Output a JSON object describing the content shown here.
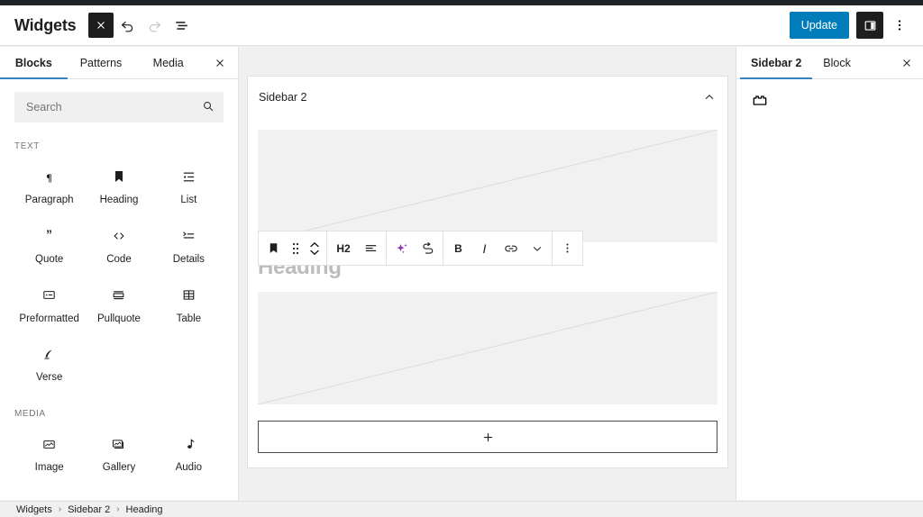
{
  "header": {
    "title": "Widgets",
    "close_label": "Close",
    "undo_label": "Undo",
    "redo_label": "Redo",
    "list_view_label": "List View",
    "update_label": "Update",
    "sidebar_toggle_label": "Settings",
    "options_label": "Options"
  },
  "inserter": {
    "tabs": [
      {
        "label": "Blocks",
        "active": true
      },
      {
        "label": "Patterns",
        "active": false
      },
      {
        "label": "Media",
        "active": false
      }
    ],
    "close_label": "Close block inserter",
    "search": {
      "placeholder": "Search",
      "value": "",
      "icon": "search-icon"
    },
    "categories": [
      {
        "label": "TEXT",
        "blocks": [
          {
            "name": "Paragraph",
            "icon": "paragraph-icon"
          },
          {
            "name": "Heading",
            "icon": "heading-icon"
          },
          {
            "name": "List",
            "icon": "list-icon"
          },
          {
            "name": "Quote",
            "icon": "quote-icon"
          },
          {
            "name": "Code",
            "icon": "code-icon"
          },
          {
            "name": "Details",
            "icon": "details-icon"
          },
          {
            "name": "Preformatted",
            "icon": "preformatted-icon"
          },
          {
            "name": "Pullquote",
            "icon": "pullquote-icon"
          },
          {
            "name": "Table",
            "icon": "table-icon"
          },
          {
            "name": "Verse",
            "icon": "verse-icon"
          }
        ]
      },
      {
        "label": "MEDIA",
        "blocks": [
          {
            "name": "Image",
            "icon": "image-icon"
          },
          {
            "name": "Gallery",
            "icon": "gallery-icon"
          },
          {
            "name": "Audio",
            "icon": "audio-icon"
          }
        ]
      }
    ]
  },
  "canvas": {
    "widget_area": {
      "title": "Sidebar 2",
      "collapse_label": "Collapse",
      "heading_placeholder": "Heading",
      "appender_label": "+"
    }
  },
  "block_toolbar": {
    "items": [
      {
        "name": "block-type-heading",
        "glyph": "bookmark"
      },
      {
        "name": "drag-handle",
        "glyph": "drag"
      },
      {
        "name": "move-updown",
        "glyph": "updown"
      },
      {
        "name": "heading-level",
        "glyph": "H2",
        "label": "H2"
      },
      {
        "name": "align-text",
        "glyph": "align"
      },
      {
        "name": "ai-assistant",
        "glyph": "sparkle"
      },
      {
        "name": "transform",
        "glyph": "transform"
      },
      {
        "name": "bold",
        "glyph": "B",
        "label": "B"
      },
      {
        "name": "italic",
        "glyph": "I",
        "label": "I"
      },
      {
        "name": "link",
        "glyph": "link"
      },
      {
        "name": "more-rich-text",
        "glyph": "chevron-down"
      },
      {
        "name": "block-options",
        "glyph": "kebab"
      }
    ]
  },
  "settings": {
    "tabs": [
      {
        "label": "Sidebar 2",
        "active": true
      },
      {
        "label": "Block",
        "active": false
      }
    ],
    "close_label": "Close Settings",
    "widget_icon": "widget-block-icon"
  },
  "footer": {
    "breadcrumb": [
      {
        "label": "Widgets"
      },
      {
        "label": "Sidebar 2"
      },
      {
        "label": "Heading"
      }
    ],
    "separator": "›"
  },
  "colors": {
    "accent": "#007cba",
    "tab_underline": "#3582c4",
    "admin_bar": "#1d2327",
    "ai_purple": "#8c2eb3",
    "placeholder_gray": "#f1f1f1"
  }
}
